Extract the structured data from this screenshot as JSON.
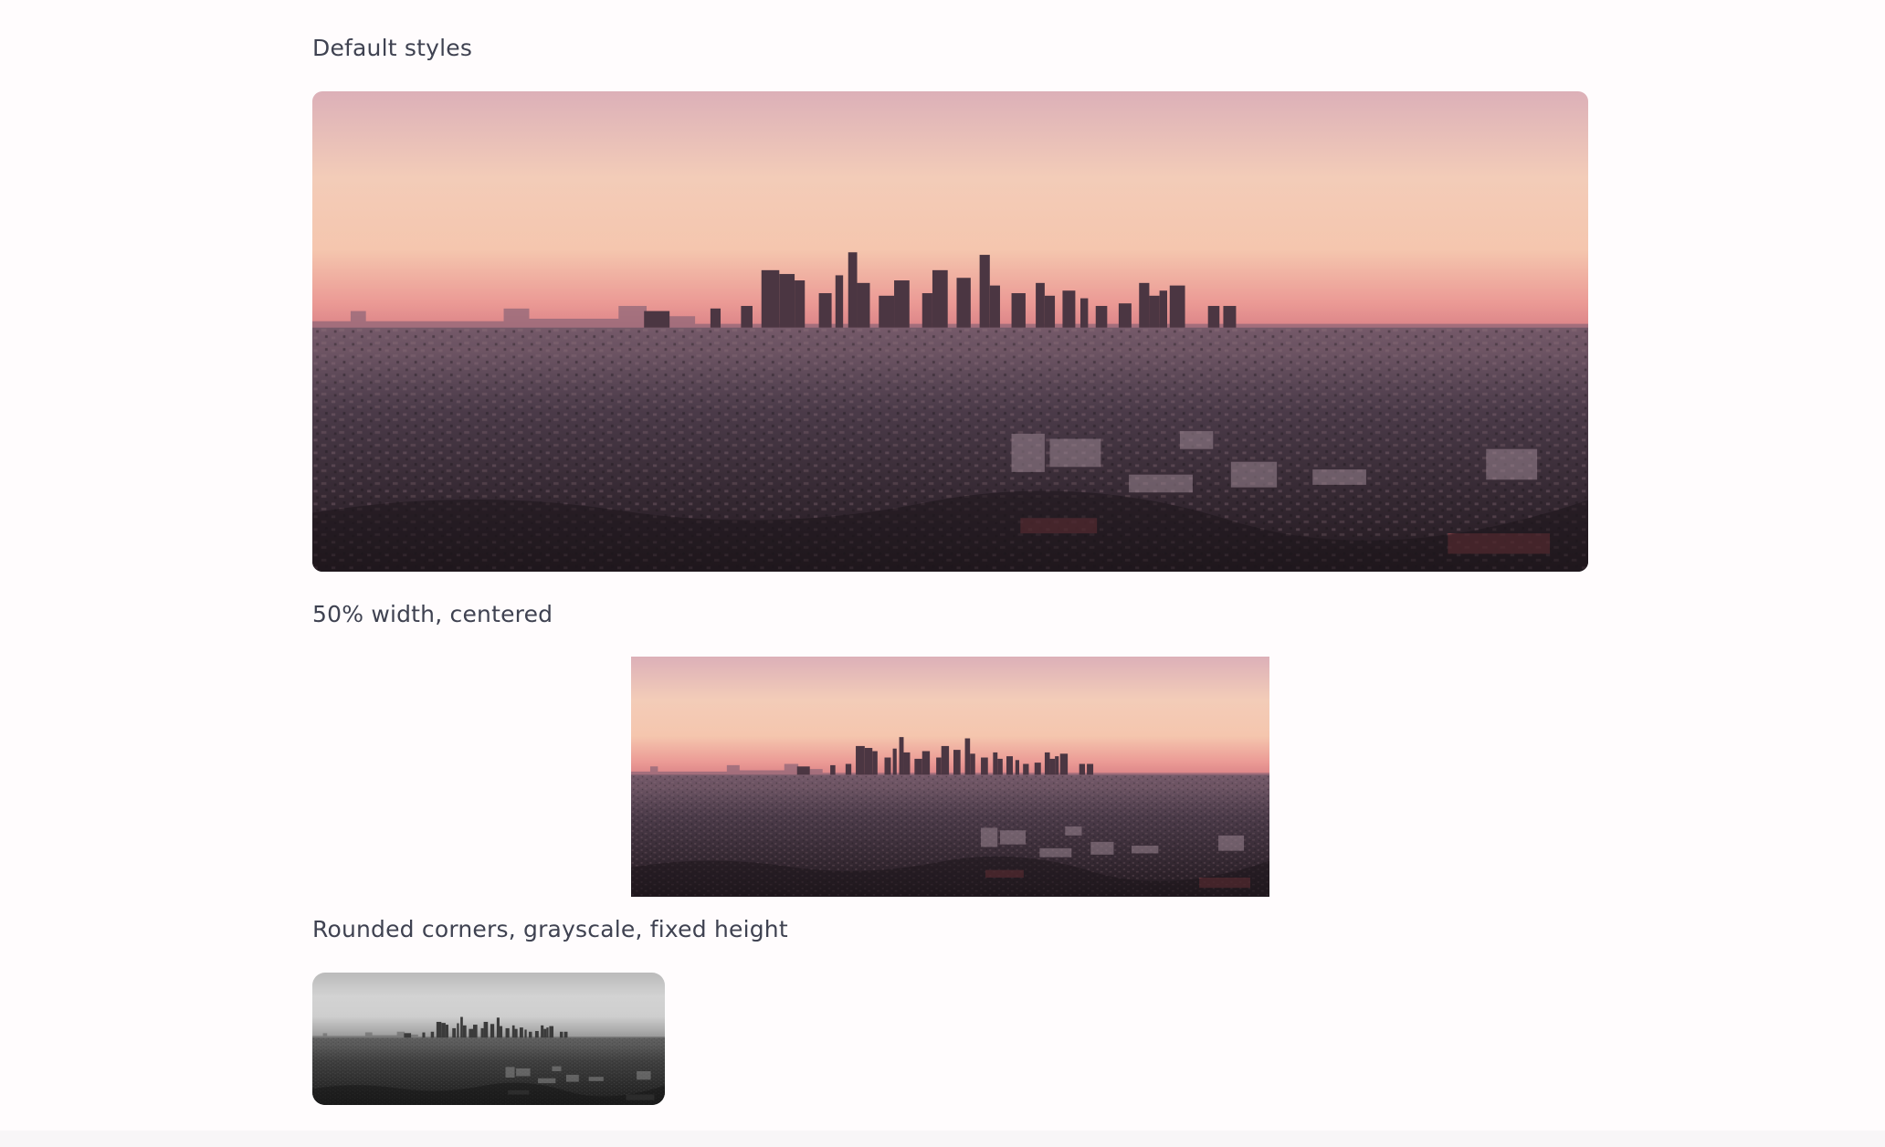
{
  "sections": [
    {
      "caption": "Default styles"
    },
    {
      "caption": "50% width, centered"
    },
    {
      "caption": "Rounded corners, grayscale, fixed height"
    }
  ],
  "image": {
    "subject": "city skyline at dusk",
    "colors": {
      "sky_top": "#e8b4b4",
      "sky_mid": "#f6d4bb",
      "sky_glow": "#e58a8c",
      "haze": "#a87a8a",
      "city": "#3a2d3a",
      "city_dark": "#231c25"
    }
  }
}
